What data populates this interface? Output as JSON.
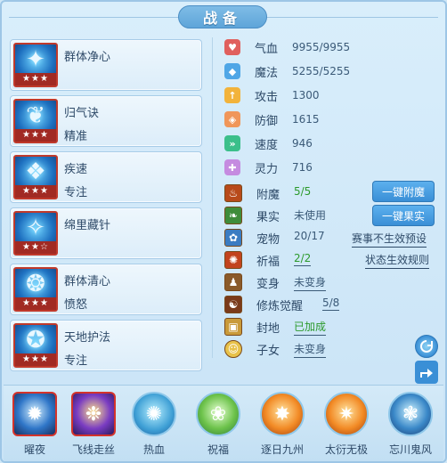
{
  "title": "战备",
  "skills": [
    {
      "name": "群体净心",
      "sub": "",
      "stars": "★★★",
      "glyph": "✦"
    },
    {
      "name": "归气诀",
      "sub": "精准",
      "stars": "★★★",
      "glyph": "❦"
    },
    {
      "name": "疾速",
      "sub": "专注",
      "stars": "★★★",
      "glyph": "❖"
    },
    {
      "name": "绵里藏针",
      "sub": "",
      "stars": "★★☆",
      "glyph": "✧"
    },
    {
      "name": "群体清心",
      "sub": "愤怒",
      "stars": "★★★",
      "glyph": "❂"
    },
    {
      "name": "天地护法",
      "sub": "专注",
      "stars": "★★★",
      "glyph": "✪"
    }
  ],
  "attributes": [
    {
      "label": "气血",
      "value": "9955/9955",
      "icon": "heart-icon",
      "color": "#e0605e"
    },
    {
      "label": "魔法",
      "value": "5255/5255",
      "icon": "diamond-icon",
      "color": "#4fa6e6"
    },
    {
      "label": "攻击",
      "value": "1300",
      "icon": "attack-icon",
      "color": "#f2b33b"
    },
    {
      "label": "防御",
      "value": "1615",
      "icon": "shield-icon",
      "color": "#f0965a"
    },
    {
      "label": "速度",
      "value": "946",
      "icon": "speed-icon",
      "color": "#3bbf8a"
    },
    {
      "label": "灵力",
      "value": "716",
      "icon": "spirit-icon",
      "color": "#c58be0"
    }
  ],
  "status": [
    {
      "label": "附魔",
      "value": "5/5",
      "icon": "enchant-icon",
      "style": "green"
    },
    {
      "label": "果实",
      "value": "未使用",
      "icon": "fruit-icon",
      "style": "plain"
    },
    {
      "label": "宠物",
      "value": "20/17",
      "icon": "pet-icon",
      "style": "plain"
    },
    {
      "label": "祈福",
      "value": "2/2",
      "icon": "bless-icon",
      "style": "green-underline"
    },
    {
      "label": "变身",
      "value": "未变身",
      "icon": "transform-icon",
      "style": "underline"
    },
    {
      "label": "修炼觉醒",
      "value": "5/8",
      "icon": "cultivate-icon",
      "style": "underline"
    },
    {
      "label": "封地",
      "value": "已加成",
      "icon": "fief-icon",
      "style": "green-underline"
    },
    {
      "label": "子女",
      "value": "未变身",
      "icon": "children-icon",
      "style": "underline"
    }
  ],
  "buttons": {
    "enchant": "一键附魔",
    "fruit": "一键果实",
    "preset": "赛事不生效预设",
    "rules": "状态生效规则"
  },
  "bottom": [
    {
      "label": "曜夜",
      "glyph": "✹"
    },
    {
      "label": "飞线走丝",
      "glyph": "❉"
    },
    {
      "label": "热血",
      "glyph": "✺"
    },
    {
      "label": "祝福",
      "glyph": "❀"
    },
    {
      "label": "逐日九州",
      "glyph": "✸"
    },
    {
      "label": "太衍无极",
      "glyph": "✷"
    },
    {
      "label": "忘川鬼风",
      "glyph": "❃"
    }
  ]
}
